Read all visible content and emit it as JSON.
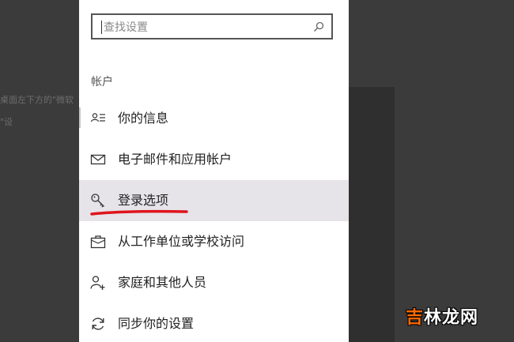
{
  "background": {
    "left_text_line1": "桌面左下方的\"微软",
    "left_text_line2": "\"设"
  },
  "search": {
    "placeholder": "查找设置",
    "icon": "search-icon"
  },
  "section": {
    "title": "帐户"
  },
  "nav": {
    "items": [
      {
        "label": "你的信息",
        "icon": "contact-card-icon"
      },
      {
        "label": "电子邮件和应用帐户",
        "icon": "mail-icon"
      },
      {
        "label": "登录选项",
        "icon": "key-icon",
        "selected": true
      },
      {
        "label": "从工作单位或学校访问",
        "icon": "briefcase-icon"
      },
      {
        "label": "家庭和其他人员",
        "icon": "add-person-icon"
      },
      {
        "label": "同步你的设置",
        "icon": "sync-icon"
      }
    ]
  },
  "watermark": {
    "first_char": "吉",
    "rest": "林龙网"
  },
  "colors": {
    "panel_bg": "#ffffff",
    "selected_bg": "#e6e4e8",
    "annotation_red": "#e0141e",
    "backdrop": "#3a3a3a"
  }
}
